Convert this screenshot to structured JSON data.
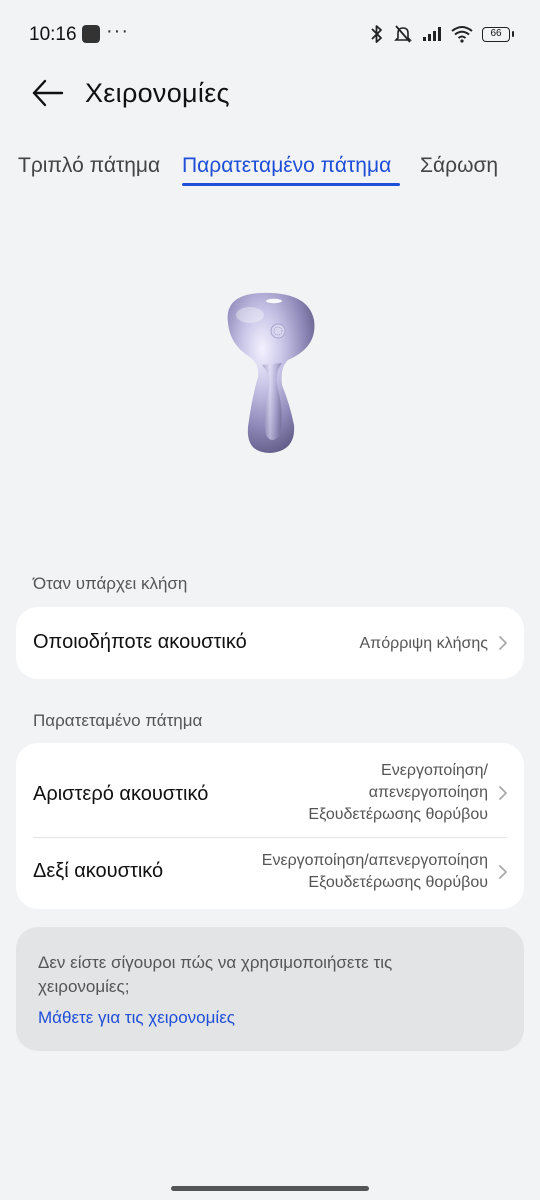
{
  "status_bar": {
    "time": "10:16",
    "more": "···",
    "battery": "66"
  },
  "header": {
    "title": "Χειρονομίες"
  },
  "tabs": [
    {
      "label": "Τριπλό πάτημα",
      "active": false
    },
    {
      "label": "Παρατεταμένο πάτημα",
      "active": true
    },
    {
      "label": "Σάρωση",
      "active": false
    }
  ],
  "call_section": {
    "label": "Όταν υπάρχει κλήση",
    "rows": [
      {
        "label": "Οποιοδήποτε ακουστικό",
        "value": "Απόρριψη κλήσης"
      }
    ]
  },
  "press_section": {
    "label": "Παρατεταμένο πάτημα",
    "rows": [
      {
        "label": "Αριστερό ακουστικό",
        "value_lines": [
          "Ενεργοποίηση/",
          "απενεργοποίηση",
          "Εξουδετέρωσης θορύβου"
        ]
      },
      {
        "label": "Δεξί ακουστικό",
        "value_lines": [
          "Ενεργοποίηση/απενεργοποίηση",
          "Εξουδετέρωσης θορύβου"
        ]
      }
    ]
  },
  "help": {
    "text": "Δεν είστε σίγουροι πώς να χρησιμοποιήσετε τις χειρονομίες;",
    "link": "Μάθετε για τις χειρονομίες"
  },
  "colors": {
    "accent": "#1f4ed8",
    "background": "#f1f3f5",
    "card": "#ffffff",
    "help_card": "#e2e4e6"
  }
}
